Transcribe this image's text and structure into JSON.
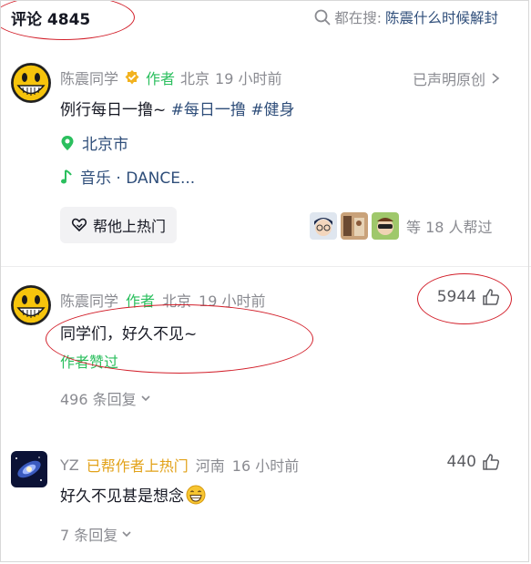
{
  "header": {
    "comment_title": "评论 4845",
    "search_prefix": "都在搜:",
    "search_topic": "陈震什么时候解封"
  },
  "post": {
    "author": "陈震同学",
    "author_badge": "作者",
    "location": "北京",
    "time": "19 小时前",
    "original_claim": "已声明原创",
    "text_plain": "例行每日一撸~ ",
    "tags": [
      "#每日一撸",
      "#健身"
    ],
    "place": "北京市",
    "music": "音乐 · DANCE...",
    "promote_button": "帮他上热门",
    "helpers_text": "等 18 人帮过"
  },
  "comments": [
    {
      "author": "陈震同学",
      "badge": "作者",
      "location": "北京",
      "time": "19 小时前",
      "likes": "5944",
      "text": "同学们，好久不见~",
      "liked_by_author": "作者赞过",
      "replies": "496 条回复"
    },
    {
      "author": "YZ",
      "badge": "已帮作者上热门",
      "location": "河南",
      "time": "16 小时前",
      "likes": "440",
      "text": "好久不见甚是想念",
      "replies": "7 条回复"
    }
  ],
  "colors": {
    "author_green": "#2bbf5e",
    "hot_gold": "#e2a21a",
    "link_blue": "#2f4e7a",
    "annotation_red": "#d21f2a"
  },
  "icons": [
    "search-icon",
    "verified-icon",
    "chevron-right-icon",
    "location-pin-icon",
    "music-note-icon",
    "heart-hand-icon",
    "thumbs-up-icon",
    "chevron-down-icon",
    "grin-emoji-icon"
  ]
}
